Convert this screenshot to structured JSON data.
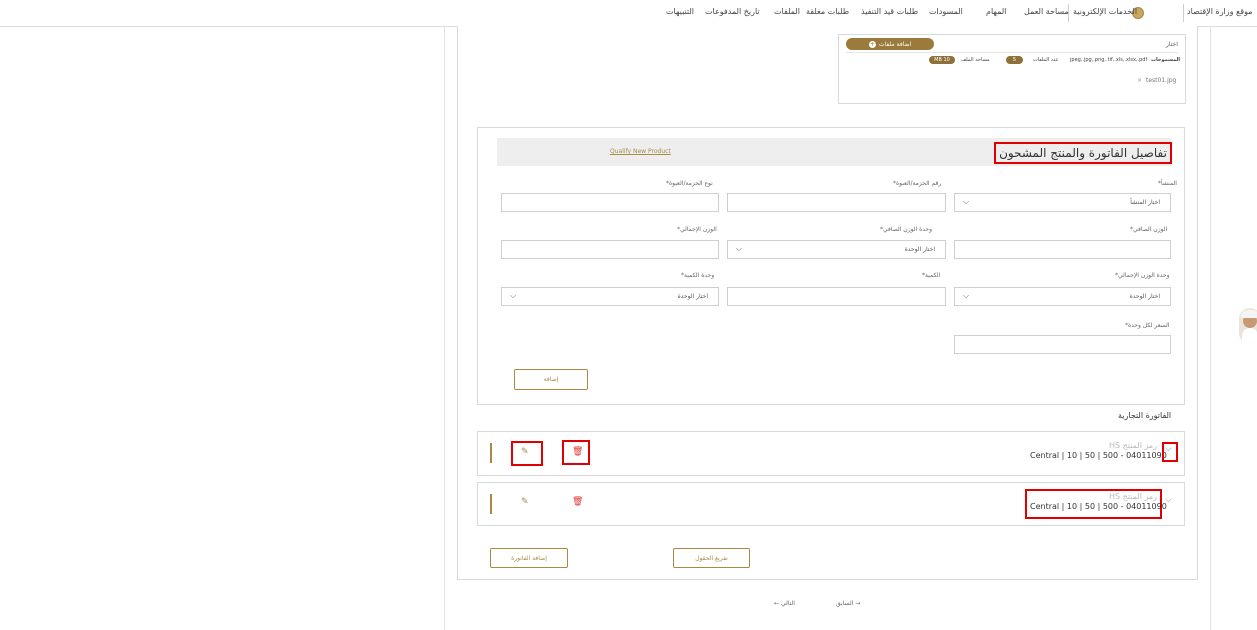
{
  "nav": {
    "items": [
      "موقع وزارة الإقتصاد",
      "الخدمات الإلكترونية",
      "مساحة العمل",
      "المهام",
      "المسودات",
      "طلبات قيد التنفيذ",
      "طلبات مغلقة",
      "الملفات",
      "تاريخ المدفوعات",
      "التنبيهات"
    ]
  },
  "attachments": {
    "choose": "اختار",
    "add_files": "اضافة ملفات",
    "attachments_label": "المسموحات",
    "allowed_types": "jpeg,.jpg,.png,.tif,.xls,.xlsx,.pdf",
    "file_count_label": "عدد الملفات",
    "file_count": "5",
    "file_size_label": "مساحة الملف",
    "file_size": "10 MB",
    "file_name": "test01.jpg"
  },
  "invoice_section": {
    "title": "تفاصيل الفاتورة والمنتج المشحون",
    "qualify_link": "Qualify New Product",
    "fields": {
      "origin_label": "المنشأ*",
      "origin_value": "اختار المنشأ",
      "package_number_label": "رقم الحزمة/العبوة*",
      "package_type_label": "نوع الحزمة/العبوة*",
      "net_weight_label": "الوزن الصافي*",
      "net_weight_unit_label": "وحدة الوزن الصافي*",
      "net_weight_unit_value": "اختار الوحدة",
      "gross_weight_label": "الوزن الإجمالي*",
      "gross_weight_unit_label": "وحدة الوزن الإجمالي*",
      "gross_weight_unit_value": "اختار الوحدة",
      "quantity_label": "الكمية*",
      "quantity_unit_label": "وحدة الكمية*",
      "quantity_unit_value": "اختار الوحدة",
      "unit_price_label": "السعر لكل وحدة*"
    },
    "add_button": "إضافة"
  },
  "commercial_invoice": {
    "heading": "الفاتورة التجارية",
    "items": [
      {
        "hs_label": "رمز المنتج HS",
        "value": "Central | 10 | 50 | 500 - 04011090"
      },
      {
        "hs_label": "رمز المنتج HS",
        "value": "Central | 10 | 50 | 500 - 04011090"
      }
    ],
    "clear_fields": "تفريغ الحقول",
    "add_invoice": "إضافة الفاتورة"
  },
  "pagination": {
    "previous": "السابق",
    "next": "التالي"
  },
  "icons": [
    "globe-icon",
    "plus-circle-icon",
    "close-icon",
    "chevron-down-icon",
    "edit-icon",
    "trash-icon",
    "arrow-right-icon",
    "arrow-left-icon"
  ],
  "colors": {
    "accent": "#a88a45",
    "highlight": "#e00000"
  }
}
